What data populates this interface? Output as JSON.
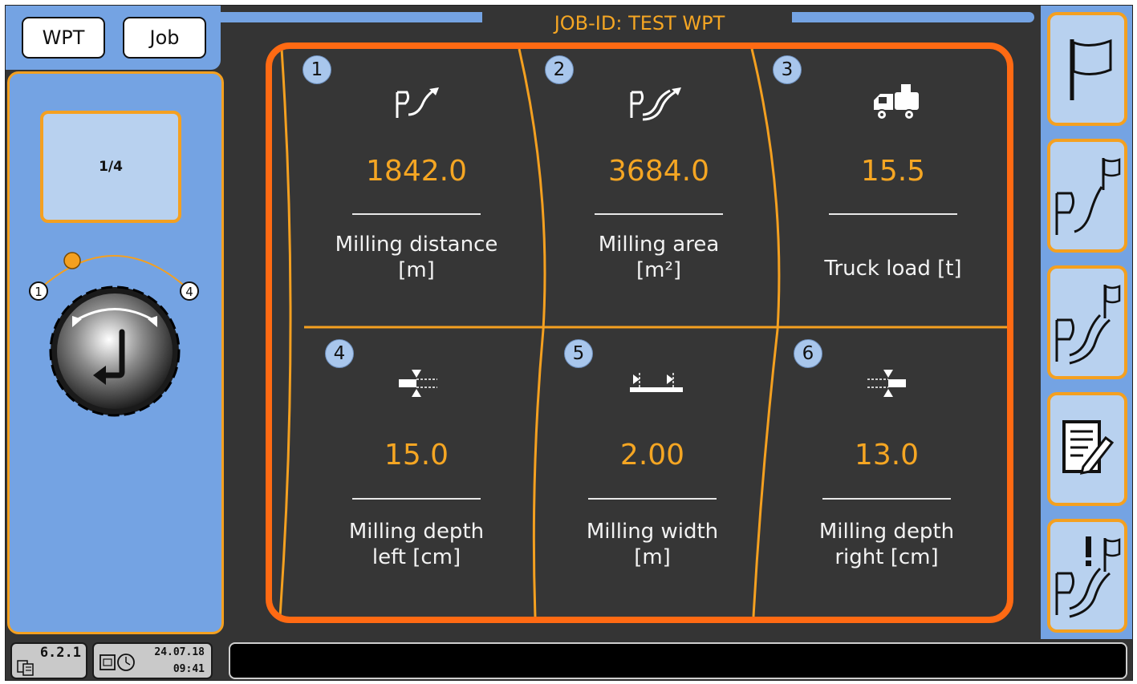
{
  "header": {
    "tabs": [
      {
        "label": "WPT"
      },
      {
        "label": "Job"
      }
    ],
    "job_title": "JOB-ID: TEST WPT"
  },
  "left_panel": {
    "page_indicator": "1/4",
    "dial": {
      "min_label": "1",
      "max_label": "4",
      "position": 1
    }
  },
  "cells": [
    {
      "number": "1",
      "icon": "milling-distance-icon",
      "value": "1842.0",
      "label": "Milling distance\n[m]"
    },
    {
      "number": "2",
      "icon": "milling-area-icon",
      "value": "3684.0",
      "label": "Milling area\n[m²]"
    },
    {
      "number": "3",
      "icon": "truck-load-icon",
      "value": "15.5",
      "label": "Truck load [t]"
    },
    {
      "number": "4",
      "icon": "depth-left-icon",
      "value": "15.0",
      "label": "Milling depth\nleft [cm]"
    },
    {
      "number": "5",
      "icon": "milling-width-icon",
      "value": "2.00",
      "label": "Milling width\n[m]"
    },
    {
      "number": "6",
      "icon": "depth-right-icon",
      "value": "13.0",
      "label": "Milling depth\nright [cm]"
    }
  ],
  "sidebar": {
    "buttons": [
      {
        "icon": "start-flag-icon"
      },
      {
        "icon": "road-flag-icon"
      },
      {
        "icon": "area-flag-icon"
      },
      {
        "icon": "notes-edit-icon"
      },
      {
        "icon": "warning-flag-icon"
      }
    ]
  },
  "status_bar": {
    "version": "6.2.1",
    "date": "24.07.18",
    "time": "09:41",
    "message": ""
  },
  "colors": {
    "accent_orange": "#f5a623",
    "frame_orange": "#ff6a13",
    "panel_blue": "#74a3e3",
    "button_blue": "#b8d1ef",
    "background": "#343434"
  }
}
